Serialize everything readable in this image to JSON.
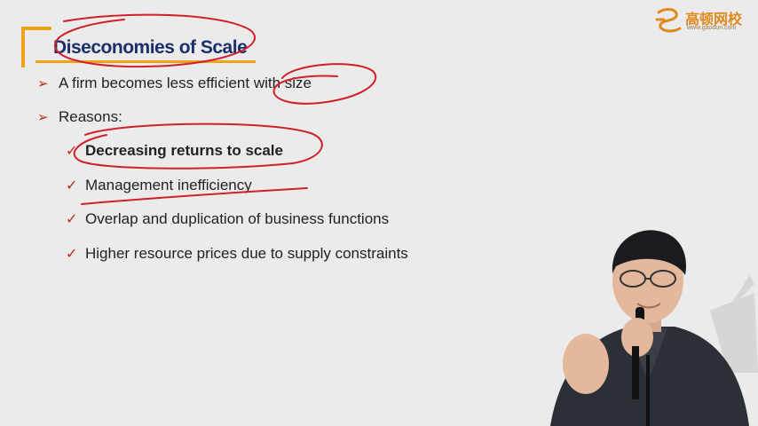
{
  "logo": {
    "name": "高顿网校",
    "url": "www.gaodun.com"
  },
  "slide": {
    "title": "Diseconomies of Scale",
    "bullets": [
      {
        "text": "A firm becomes less efficient with size"
      },
      {
        "text": "Reasons:"
      }
    ],
    "reasons": [
      {
        "text": "Decreasing returns to scale",
        "bold": true
      },
      {
        "text": "Management inefficiency",
        "bold": false
      },
      {
        "text": "Overlap and duplication of business functions",
        "bold": false
      },
      {
        "text": "Higher resource prices due to supply constraints",
        "bold": false
      }
    ]
  },
  "colors": {
    "accent": "#f0a21a",
    "title": "#1c2f6b",
    "bullet": "#c0281f",
    "annotation": "#d0202a"
  }
}
